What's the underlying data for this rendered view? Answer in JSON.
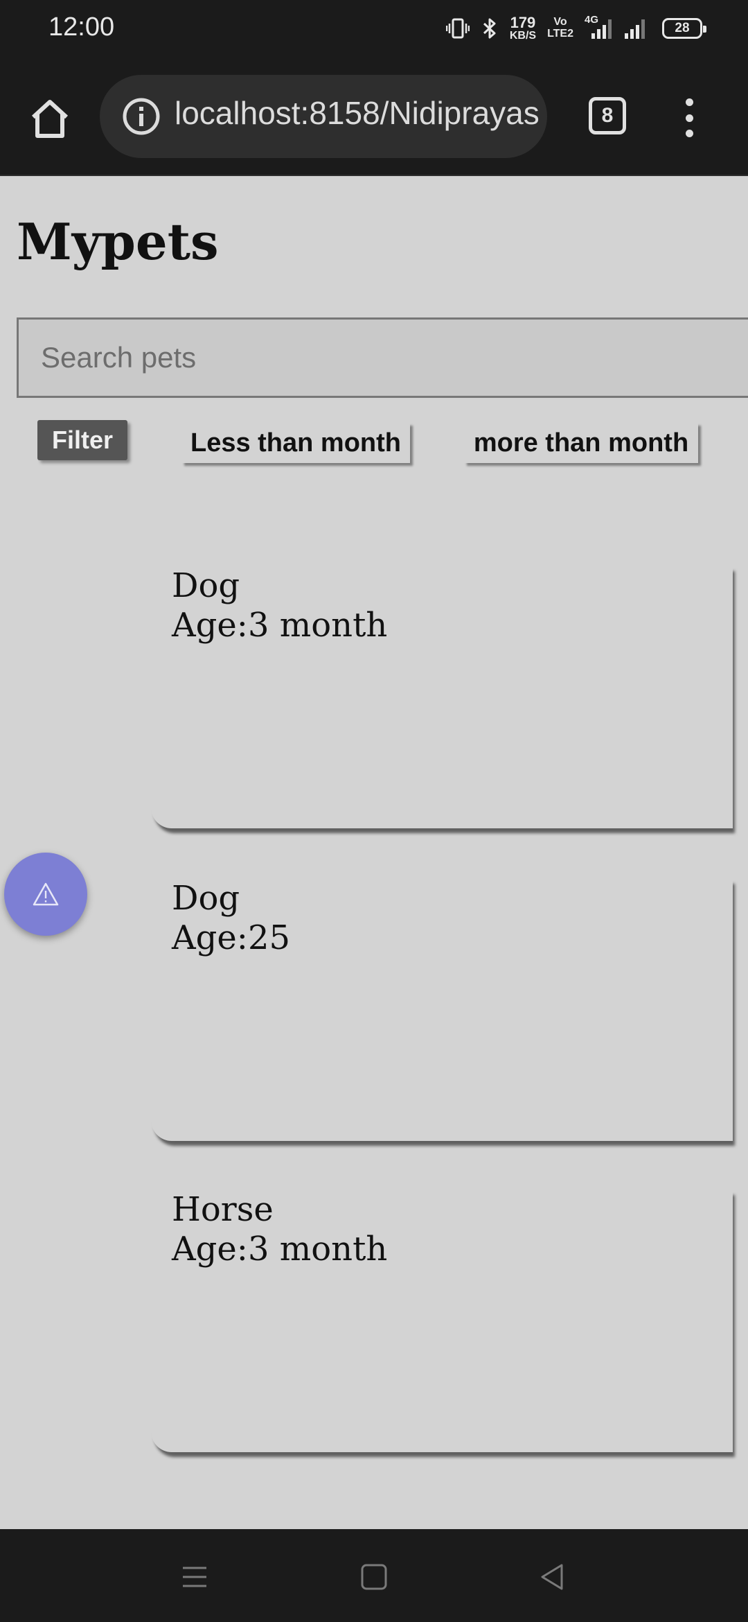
{
  "status_bar": {
    "time": "12:00",
    "net_speed_value": "179",
    "net_speed_unit": "KB/S",
    "volte_line1": "Vo",
    "volte_line2": "LTE2",
    "network_type": "4G",
    "battery": "28",
    "icons": [
      "vibrate-icon",
      "bluetooth-icon",
      "signal-icon",
      "signal-icon",
      "battery-icon"
    ]
  },
  "browser": {
    "url": "localhost:8158/Nidiprayas",
    "tab_count": "8",
    "icons": [
      "home-icon",
      "info-icon",
      "menu-icon"
    ]
  },
  "page": {
    "title": "Mypets",
    "search_placeholder": "Search pets",
    "filter_label": "Filter",
    "filter_less": "Less than month",
    "filter_more": "more than month"
  },
  "pets": [
    {
      "name": "Dog",
      "age": "Age:3 month"
    },
    {
      "name": "Dog",
      "age": "Age:25"
    },
    {
      "name": "Horse",
      "age": "Age:3 month"
    }
  ],
  "fab": {
    "icon": "warning-icon",
    "color": "#7d7fd4"
  },
  "nav": {
    "icons": [
      "recent-apps-icon",
      "home-nav-icon",
      "back-icon"
    ]
  }
}
